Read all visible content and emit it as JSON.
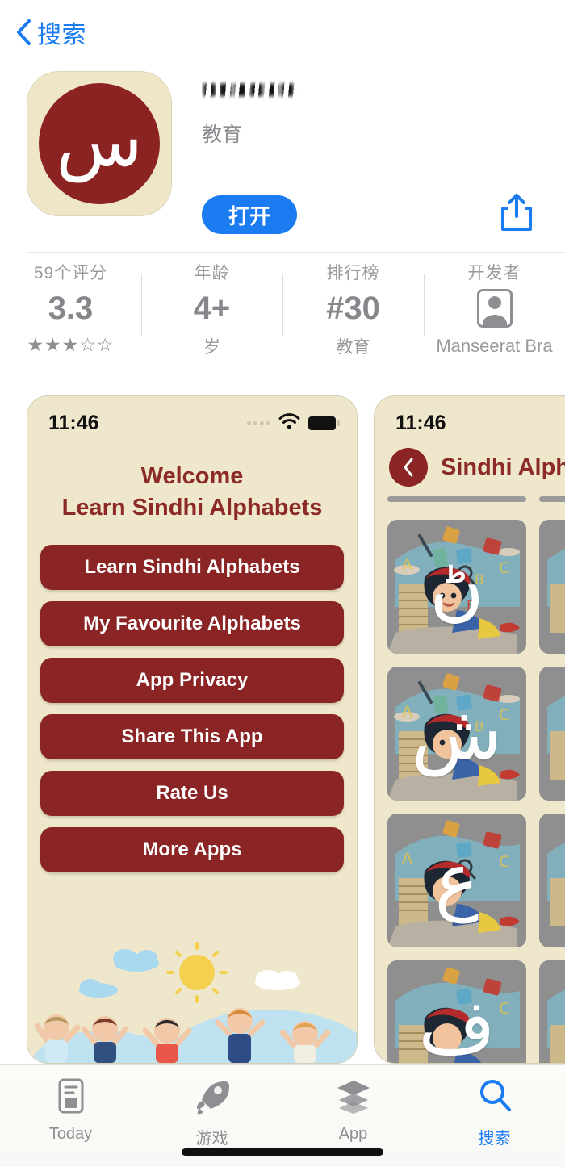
{
  "nav": {
    "back_label": "搜索",
    "back_icon": "chevron-left-icon"
  },
  "app": {
    "title_obscured": "■■■■■■",
    "subtitle": "教育",
    "icon_letter": "س",
    "open_label": "打开",
    "share_icon": "share-icon",
    "accent_color": "#1a7cf0",
    "brand_color": "#8B2525"
  },
  "stats": [
    {
      "label": "59个评分",
      "value": "3.3",
      "sub": "★★★☆☆",
      "type": "rating"
    },
    {
      "label": "年龄",
      "value": "4+",
      "sub": "岁",
      "type": "age"
    },
    {
      "label": "排行榜",
      "value": "#30",
      "sub": "教育",
      "type": "chart"
    },
    {
      "label": "开发者",
      "value": "",
      "sub": "Manseerat Bra",
      "type": "developer"
    }
  ],
  "screenshots": [
    {
      "status_time": "11:46",
      "welcome_line1": "Welcome",
      "welcome_line2": "Learn Sindhi Alphabets",
      "menu": [
        "Learn Sindhi Alphabets",
        "My Favourite Alphabets",
        "App Privacy",
        "Share This App",
        "Rate Us",
        "More Apps"
      ]
    },
    {
      "status_time": "11:46",
      "title": "Sindhi Alphabet",
      "back_icon": "chevron-left-icon",
      "letters": [
        "ڻ",
        "ش",
        "ع",
        "ف"
      ]
    }
  ],
  "tabs": [
    {
      "label": "Today",
      "icon": "today-document-icon",
      "active": false
    },
    {
      "label": "游戏",
      "icon": "rocket-icon",
      "active": false
    },
    {
      "label": "App",
      "icon": "stack-icon",
      "active": false
    },
    {
      "label": "搜索",
      "icon": "search-icon",
      "active": true
    }
  ]
}
